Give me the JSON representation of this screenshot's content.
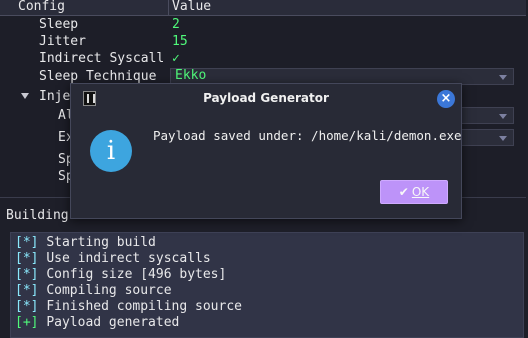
{
  "tree": {
    "col_config": "Config",
    "col_value": "Value",
    "rows": [
      {
        "key": "Sleep",
        "value": "2"
      },
      {
        "key": "Jitter",
        "value": "15"
      },
      {
        "key": "Indirect Syscall",
        "value": "✓"
      },
      {
        "key": "Sleep Technique",
        "value": "Ekko"
      }
    ],
    "injection_label": "Injection",
    "child_alloc": "Alloc",
    "child_execute": "Execute",
    "child_spawn64": "Spawn64",
    "child_spawn32": "Spawn32"
  },
  "building_label": "Building",
  "log": [
    {
      "prefix": "[*]",
      "text": "Starting build",
      "ok": false
    },
    {
      "prefix": "[*]",
      "text": "Use indirect syscalls",
      "ok": false
    },
    {
      "prefix": "[*]",
      "text": "Config size [496 bytes]",
      "ok": false
    },
    {
      "prefix": "[*]",
      "text": "Compiling source",
      "ok": false
    },
    {
      "prefix": "[*]",
      "text": "Finished compiling source",
      "ok": false
    },
    {
      "prefix": "[+]",
      "text": "Payload generated",
      "ok": true
    }
  ],
  "dialog": {
    "title": "Payload Generator",
    "message": "Payload saved under: /home/kali/demon.exe",
    "ok_label": "OK",
    "info_glyph": "i",
    "close_glyph": "×"
  },
  "colors": {
    "accent_green": "#50fa7b",
    "accent_cyan": "#8be9fd",
    "button_purple": "#bd93f9",
    "close_blue": "#3b77d8",
    "info_blue": "#3da5df"
  }
}
